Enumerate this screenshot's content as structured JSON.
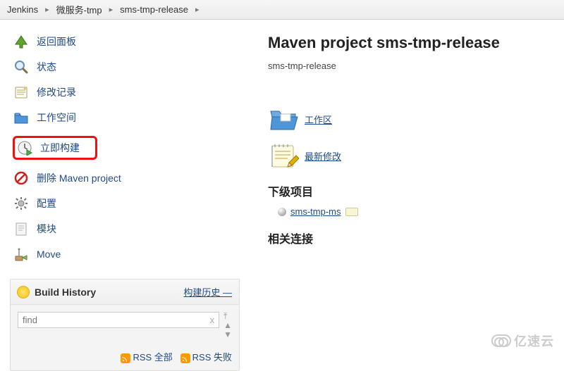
{
  "breadcrumb": {
    "root": "Jenkins",
    "level1": "微服务-tmp",
    "level2": "sms-tmp-release"
  },
  "sidebar": {
    "items": [
      {
        "label": "返回面板"
      },
      {
        "label": "状态"
      },
      {
        "label": "修改记录"
      },
      {
        "label": "工作空间"
      },
      {
        "label": "立即构建"
      },
      {
        "label": "删除 Maven project"
      },
      {
        "label": "配置"
      },
      {
        "label": "模块"
      },
      {
        "label": "Move"
      }
    ]
  },
  "history": {
    "title": "Build History",
    "trend_link": "构建历史 —",
    "search_placeholder": "find",
    "clear": "x",
    "rss_all": "RSS 全部",
    "rss_fail": "RSS 失败"
  },
  "main": {
    "title": "Maven project sms-tmp-release",
    "description": "sms-tmp-release",
    "workspace_link": "工作区",
    "changes_link": "最新修改",
    "downstream_heading": "下级项目",
    "downstream_job": "sms-tmp-ms",
    "related_heading": "相关连接"
  },
  "watermark": "亿速云"
}
